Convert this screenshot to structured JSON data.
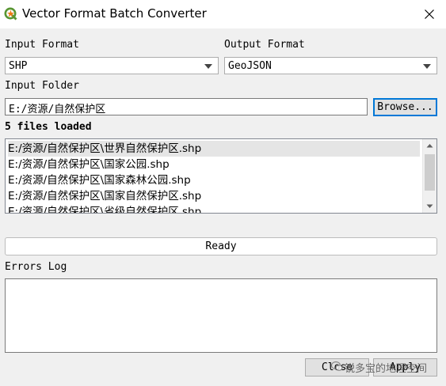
{
  "window": {
    "title": "Vector Format Batch Converter"
  },
  "form": {
    "input_format_label": "Input Format",
    "input_format_value": "SHP",
    "output_format_label": "Output Format",
    "output_format_value": "GeoJSON",
    "input_folder_label": "Input Folder",
    "input_folder_value": "E:/资源/自然保护区",
    "browse_label": "Browse...",
    "files_loaded": "5 files loaded"
  },
  "files": [
    "E:/资源/自然保护区\\世界自然保护区.shp",
    "E:/资源/自然保护区\\国家公园.shp",
    "E:/资源/自然保护区\\国家森林公园.shp",
    "E:/资源/自然保护区\\国家自然保护区.shp",
    "E:/资源/自然保护区\\省级自然保护区.shp"
  ],
  "status": {
    "text": "Ready"
  },
  "errors": {
    "label": "Errors Log",
    "content": ""
  },
  "buttons": {
    "close_label": "Close",
    "apply_label": "Apply"
  },
  "watermark": {
    "text": "锐多宝的地理空间"
  },
  "colors": {
    "focus_accent": "#0078d7",
    "qgis_green": "#589632",
    "qgis_yellow": "#ee7913"
  }
}
